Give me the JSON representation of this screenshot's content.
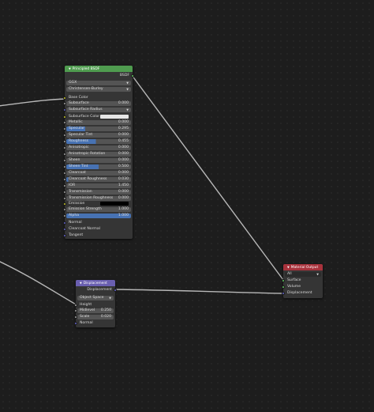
{
  "colors": {
    "shader_header": "#4f9c4f",
    "vector_header": "#6a5fb0",
    "output_header": "#a8323c",
    "link": "#b8b8b8",
    "value_bar": "#4772b3"
  },
  "principled": {
    "title": "Principled BSDF",
    "output_label": "BSDF",
    "distribution": "GGX",
    "subsurface_method": "Christensen-Burley",
    "base_color_label": "Base Color",
    "subsurface": {
      "label": "Subsurface",
      "value": "0.000"
    },
    "subsurface_radius": "Subsurface Radius",
    "subsurface_color": {
      "label": "Subsurface Color",
      "swatch": "#e6e6e6"
    },
    "sliders": [
      {
        "label": "Metallic",
        "value": "0.000",
        "fill": 0,
        "dot": "gray"
      },
      {
        "label": "Specular",
        "value": "0.295",
        "fill": 0.295,
        "dot": "gray"
      },
      {
        "label": "Specular Tint",
        "value": "0.000",
        "fill": 0,
        "dot": "gray"
      },
      {
        "label": "Roughness",
        "value": "0.455",
        "fill": 0.455,
        "dot": "gray"
      },
      {
        "label": "Anisotropic",
        "value": "0.000",
        "fill": 0,
        "dot": "gray"
      },
      {
        "label": "Anisotropic Rotation",
        "value": "0.000",
        "fill": 0,
        "dot": "gray"
      },
      {
        "label": "Sheen",
        "value": "0.000",
        "fill": 0,
        "dot": "gray"
      },
      {
        "label": "Sheen Tint",
        "value": "0.500",
        "fill": 0.5,
        "dot": "gray"
      },
      {
        "label": "Clearcoat",
        "value": "0.000",
        "fill": 0,
        "dot": "gray"
      },
      {
        "label": "Clearcoat Roughness",
        "value": "0.030",
        "fill": 0.03,
        "dot": "gray"
      },
      {
        "label": "IOR",
        "value": "1.450",
        "fill": 0,
        "dot": "gray"
      },
      {
        "label": "Transmission",
        "value": "0.000",
        "fill": 0,
        "dot": "gray"
      },
      {
        "label": "Transmission Roughness",
        "value": "0.000",
        "fill": 0,
        "dot": "gray"
      }
    ],
    "emission": {
      "label": "Emission",
      "swatch": "#000000"
    },
    "emission_strength": {
      "label": "Emission Strength",
      "value": "1.000"
    },
    "alpha": {
      "label": "Alpha",
      "value": "1.000",
      "fill": 1
    },
    "vector_inputs": [
      "Normal",
      "Clearcoat Normal",
      "Tangent"
    ]
  },
  "displacement": {
    "title": "Displacement",
    "output_label": "Displacement",
    "space": "Object Space",
    "height_label": "Height",
    "midlevel": {
      "label": "Midlevel",
      "value": "0.250"
    },
    "scale": {
      "label": "Scale",
      "value": "0.020"
    },
    "normal_label": "Normal"
  },
  "material_output": {
    "title": "Material Output",
    "target": "All",
    "inputs": [
      "Surface",
      "Volume",
      "Displacement"
    ]
  }
}
